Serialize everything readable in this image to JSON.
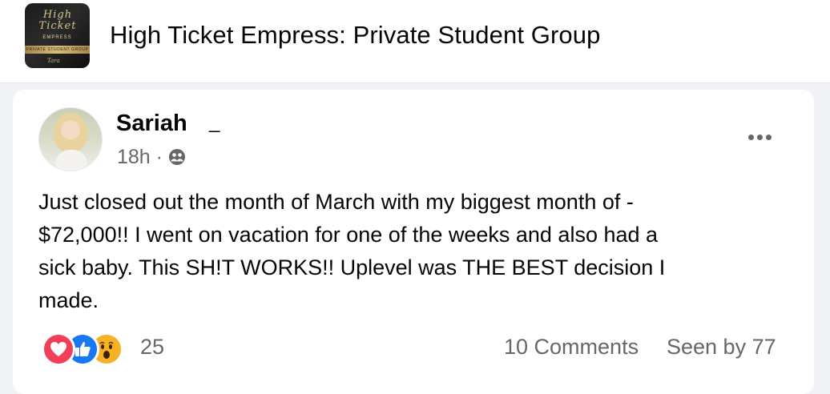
{
  "header": {
    "group_name": "High Ticket Empress: Private Student Group",
    "thumbnail": {
      "script_text": "High Ticket",
      "empress_text": "EMPRESS",
      "band_text": "PRIVATE STUDENT GROUP",
      "signature_text": "Tara"
    }
  },
  "post": {
    "author_name": "Sariah",
    "author_suffix": "_",
    "timestamp": "18h ·",
    "privacy_icon": "friends-globe-icon",
    "more_icon": "more-options-icon",
    "text": "Just closed out the month of March with my biggest month of -\n$72,000!! I went on vacation for one of the weeks and also had a\nsick baby. This SH!T WORKS!! Uplevel was THE BEST decision I\nmade.",
    "reactions": {
      "types": [
        "love",
        "like",
        "wow"
      ],
      "count": "25"
    },
    "comments_label": "10 Comments",
    "seen_by_label": "Seen by 77"
  },
  "colors": {
    "background": "#f0f2f5",
    "card": "#ffffff",
    "text_primary": "#050505",
    "text_secondary": "#65676b",
    "love": "#f33e58",
    "like": "#1877f2",
    "wow": "#f7b125"
  }
}
